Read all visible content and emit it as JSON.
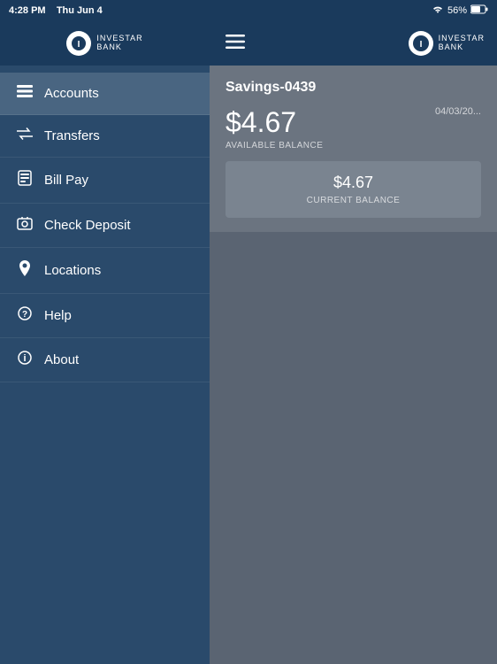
{
  "statusBar": {
    "time": "4:28 PM",
    "date": "Thu Jun 4",
    "signal": "56%",
    "battery": "▮"
  },
  "sidebar": {
    "logo": {
      "icon": "★",
      "name": "INVESTAR",
      "sub": "BANK"
    },
    "items": [
      {
        "id": "accounts",
        "label": "Accounts",
        "icon": "☰"
      },
      {
        "id": "transfers",
        "label": "Transfers",
        "icon": "⇄"
      },
      {
        "id": "billpay",
        "label": "Bill Pay",
        "icon": "📋"
      },
      {
        "id": "checkdeposit",
        "label": "Check Deposit",
        "icon": "📷"
      },
      {
        "id": "locations",
        "label": "Locations",
        "icon": "📍"
      },
      {
        "id": "help",
        "label": "Help",
        "icon": "❓"
      },
      {
        "id": "about",
        "label": "About",
        "icon": "ℹ"
      }
    ]
  },
  "header": {
    "hamburgerLabel": "☰",
    "logo": {
      "icon": "★",
      "name": "INVESTAR",
      "sub": "BANK"
    }
  },
  "account": {
    "title": "Savings-0439",
    "availableBalance": "$4.67",
    "availableLabel": "AVAILABLE BALANCE",
    "currentBalance": "$4.67",
    "currentLabel": "CURRENT BALANCE",
    "date": "04/03/20..."
  }
}
